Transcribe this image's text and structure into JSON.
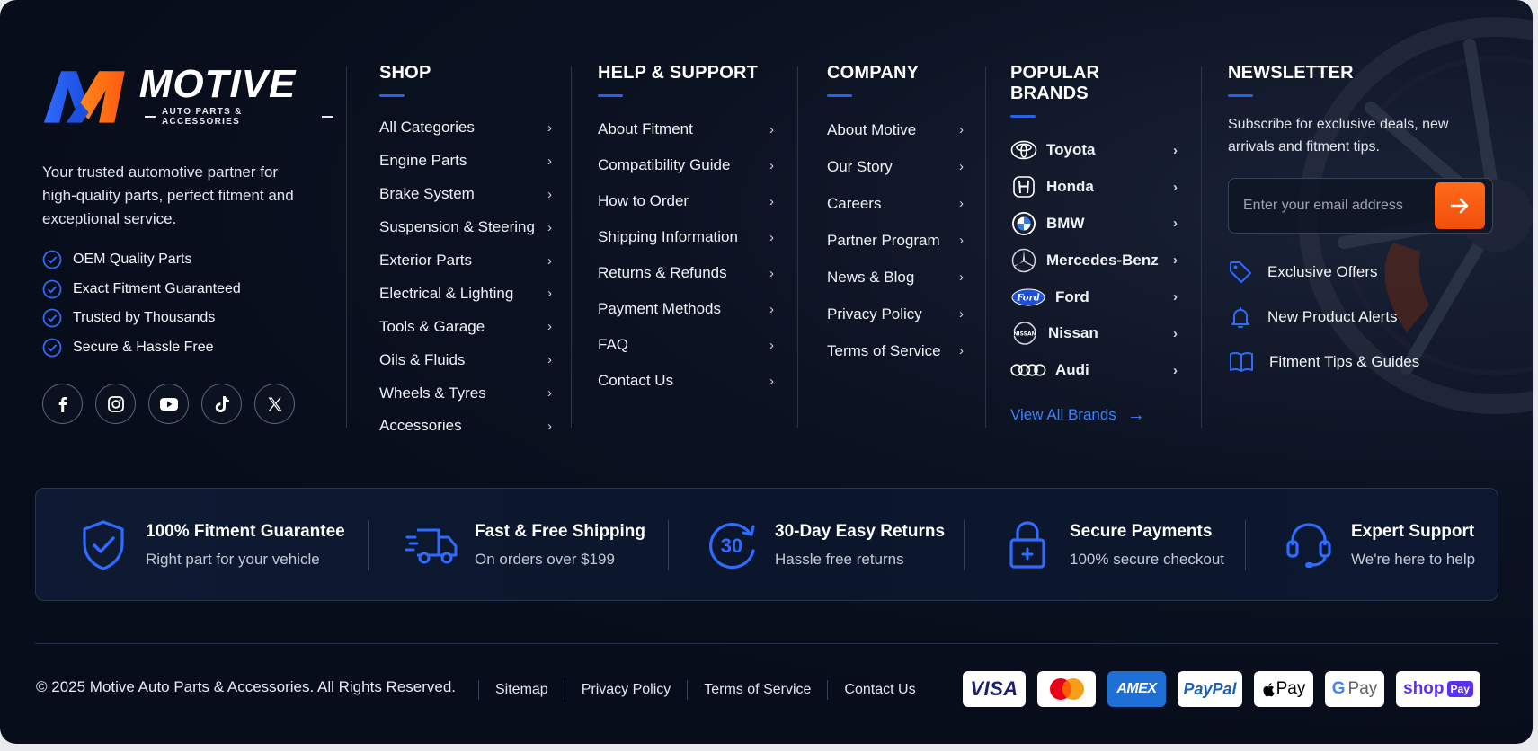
{
  "brand": {
    "name": "MOTIVE",
    "tagline": "AUTO PARTS & ACCESSORIES",
    "description": "Your trusted automotive partner for high-quality parts, perfect fitment and exceptional service.",
    "features": [
      "OEM Quality Parts",
      "Exact Fitment Guaranteed",
      "Trusted by Thousands",
      "Secure & Hassle Free"
    ],
    "socials": [
      "facebook-icon",
      "instagram-icon",
      "youtube-icon",
      "tiktok-icon",
      "x-icon"
    ]
  },
  "shop": {
    "title": "SHOP",
    "items": [
      "All Categories",
      "Engine Parts",
      "Brake System",
      "Suspension & Steering",
      "Exterior Parts",
      "Electrical & Lighting",
      "Tools & Garage",
      "Oils & Fluids",
      "Wheels & Tyres",
      "Accessories"
    ]
  },
  "help": {
    "title": "HELP & SUPPORT",
    "items": [
      "About Fitment",
      "Compatibility Guide",
      "How to Order",
      "Shipping Information",
      "Returns & Refunds",
      "Payment Methods",
      "FAQ",
      "Contact Us"
    ]
  },
  "company": {
    "title": "COMPANY",
    "items": [
      "About Motive",
      "Our Story",
      "Careers",
      "Partner Program",
      "News & Blog",
      "Privacy Policy",
      "Terms of Service"
    ]
  },
  "brands": {
    "title": "POPULAR BRANDS",
    "items": [
      "Toyota",
      "Honda",
      "BMW",
      "Mercedes-Benz",
      "Ford",
      "Nissan",
      "Audi"
    ],
    "view_all": "View All Brands"
  },
  "newsletter": {
    "title": "NEWSLETTER",
    "text": "Subscribe for exclusive deals, new arrivals and fitment tips.",
    "placeholder": "Enter your email address",
    "perks": [
      "Exclusive Offers",
      "New Product Alerts",
      "Fitment Tips & Guides"
    ]
  },
  "featurebar": [
    {
      "title": "100% Fitment Guarantee",
      "sub": "Right part for your vehicle",
      "icon": "shield-check-icon"
    },
    {
      "title": "Fast & Free Shipping",
      "sub": "On orders over $199",
      "icon": "truck-icon"
    },
    {
      "title": "30-Day Easy Returns",
      "sub": "Hassle free returns",
      "icon": "returns-30-icon",
      "badge": "30"
    },
    {
      "title": "Secure Payments",
      "sub": "100% secure checkout",
      "icon": "lock-icon"
    },
    {
      "title": "Expert Support",
      "sub": "We're here to help",
      "icon": "headset-icon"
    }
  ],
  "footer": {
    "copyright": "© 2025 Motive Auto Parts & Accessories. All Rights Reserved.",
    "links": [
      "Sitemap",
      "Privacy Policy",
      "Terms of Service",
      "Contact Us"
    ],
    "payments": {
      "visa": "VISA",
      "amex": "AMEX",
      "paypal": "PayPal",
      "applepay": "Pay",
      "googlepay": "Pay",
      "shop": "shop",
      "shop_badge": "Pay"
    }
  },
  "colors": {
    "accent": "#2563eb",
    "cta": "#f5570f",
    "background": "#070d1a"
  }
}
